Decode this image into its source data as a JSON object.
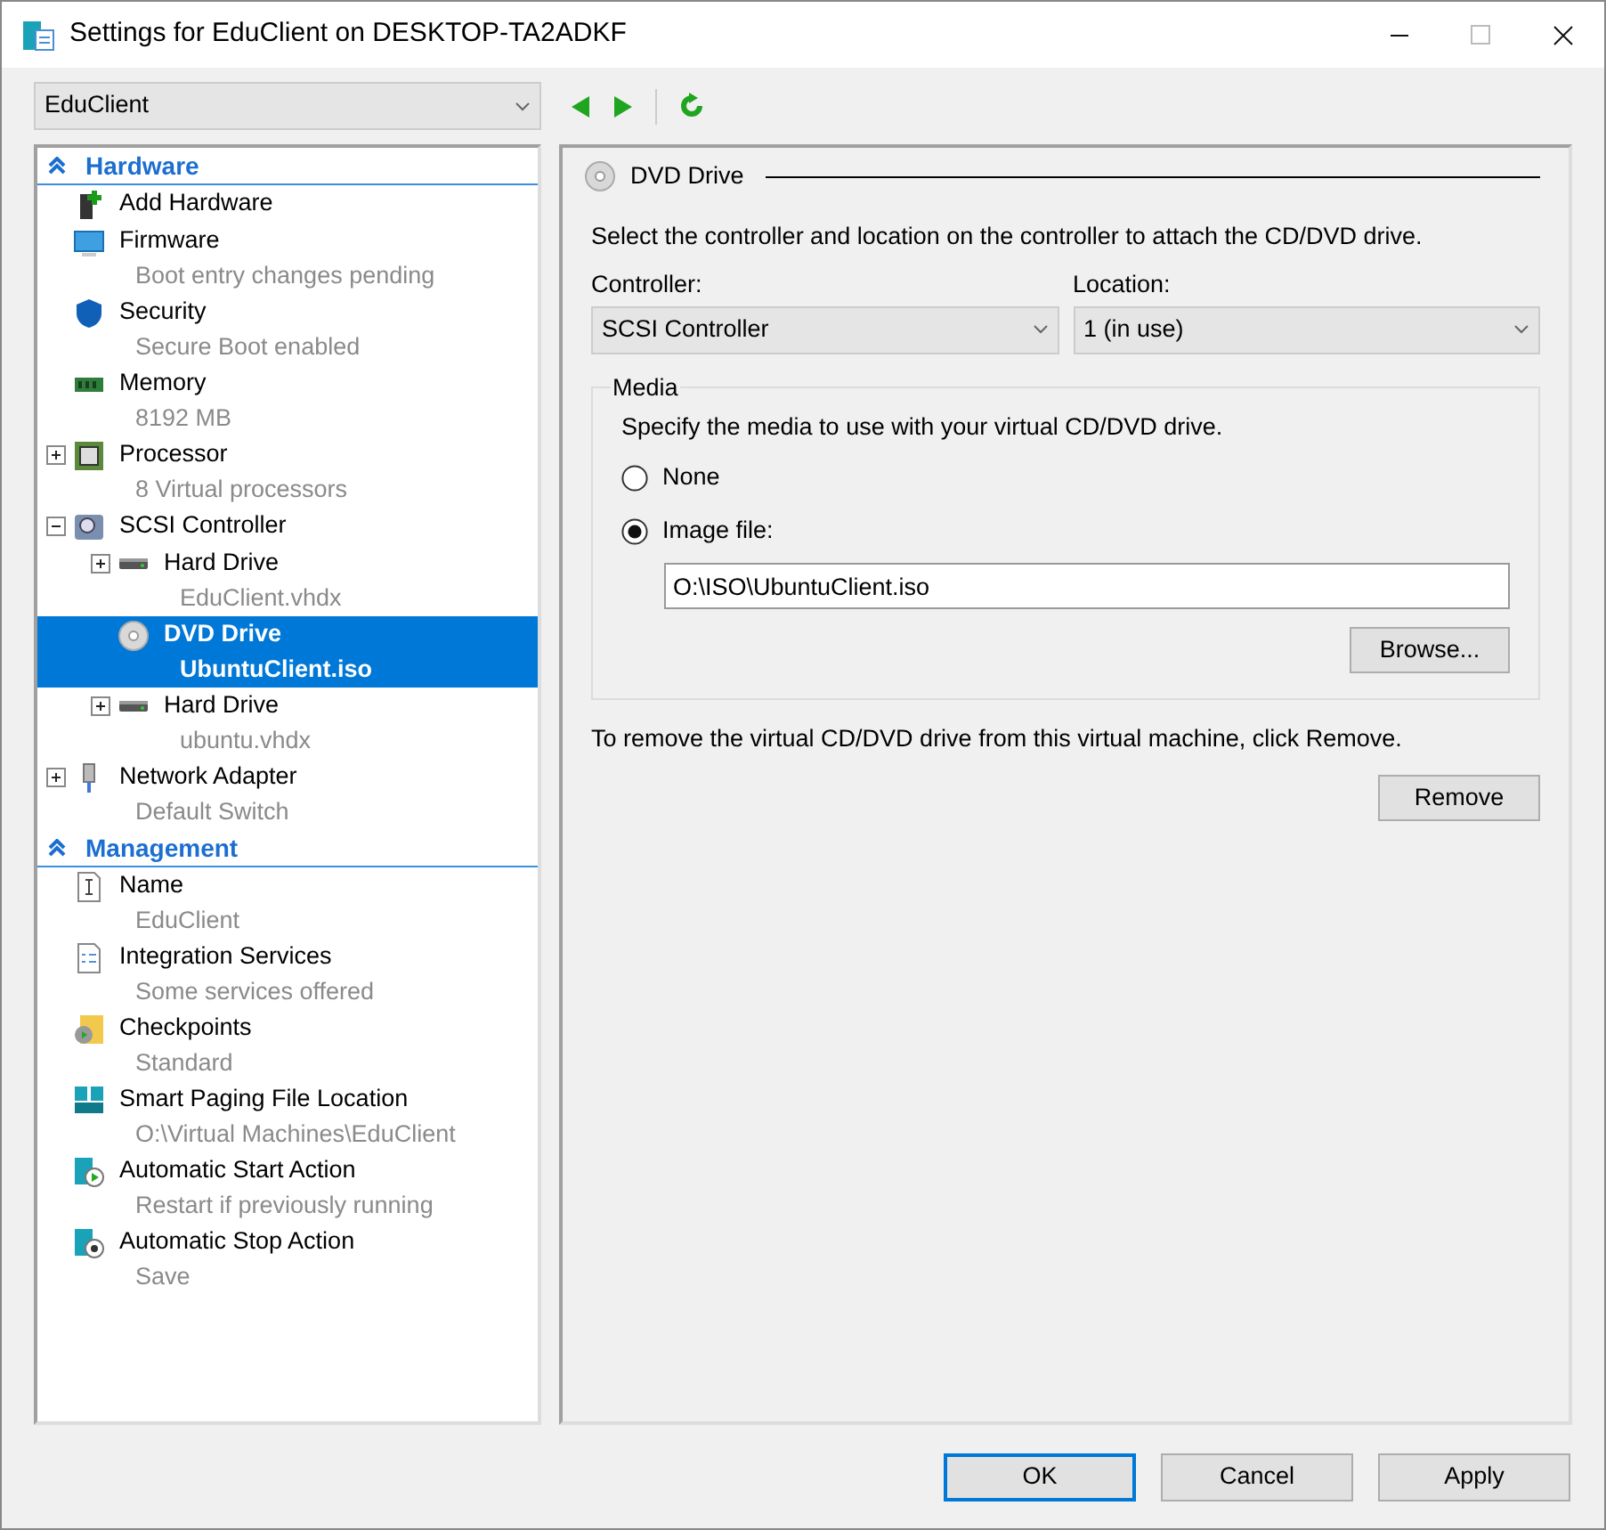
{
  "window": {
    "title": "Settings for EduClient on DESKTOP-TA2ADKF"
  },
  "vm_selector": {
    "value": "EduClient"
  },
  "sections": [
    {
      "title": "Hardware",
      "expanded": true,
      "items": [
        {
          "kind": "add",
          "label": "Add Hardware",
          "selected": false
        },
        {
          "kind": "firmware",
          "label": "Firmware",
          "detail": "Boot entry changes pending",
          "selected": false
        },
        {
          "kind": "shield",
          "label": "Security",
          "detail": "Secure Boot enabled",
          "selected": false
        },
        {
          "kind": "memory",
          "label": "Memory",
          "detail": "8192 MB",
          "selected": false
        },
        {
          "kind": "cpu",
          "label": "Processor",
          "detail": "8 Virtual processors",
          "selected": false,
          "expanded": false
        },
        {
          "kind": "controller",
          "label": "SCSI Controller",
          "selected": false,
          "expanded": true,
          "children": [
            {
              "kind": "disk",
              "label": "Hard Drive",
              "detail": "EduClient.vhdx",
              "selected": false,
              "expanded": false
            },
            {
              "kind": "dvd",
              "label": "DVD Drive",
              "detail": "UbuntuClient.iso",
              "selected": true
            },
            {
              "kind": "disk",
              "label": "Hard Drive",
              "detail": "ubuntu.vhdx",
              "selected": false,
              "expanded": false
            }
          ]
        },
        {
          "kind": "network",
          "label": "Network Adapter",
          "detail": "Default Switch",
          "selected": false,
          "expanded": false
        }
      ]
    },
    {
      "title": "Management",
      "expanded": true,
      "items": [
        {
          "kind": "name",
          "label": "Name",
          "detail": "EduClient",
          "selected": false
        },
        {
          "kind": "services",
          "label": "Integration Services",
          "detail": "Some services offered",
          "selected": false
        },
        {
          "kind": "checkpoint",
          "label": "Checkpoints",
          "detail": "Standard",
          "selected": false
        },
        {
          "kind": "paging",
          "label": "Smart Paging File Location",
          "detail": "O:\\Virtual Machines\\EduClient",
          "selected": false
        },
        {
          "kind": "start",
          "label": "Automatic Start Action",
          "detail": "Restart if previously running",
          "selected": false
        },
        {
          "kind": "stop",
          "label": "Automatic Stop Action",
          "detail": "Save",
          "selected": false
        }
      ]
    }
  ],
  "panel": {
    "title": "DVD Drive",
    "intro": "Select the controller and location on the controller to attach the CD/DVD drive.",
    "controller": {
      "label": "Controller:",
      "value": "SCSI Controller"
    },
    "location": {
      "label": "Location:",
      "value": "1 (in use)"
    },
    "media": {
      "title": "Media",
      "hint": "Specify the media to use with your virtual CD/DVD drive.",
      "options": [
        {
          "label": "None",
          "selected": false
        },
        {
          "label": "Image file:",
          "selected": true
        }
      ],
      "path": "O:\\ISO\\UbuntuClient.iso",
      "browse": "Browse..."
    },
    "remove_hint": "To remove the virtual CD/DVD drive from this virtual machine, click Remove.",
    "remove": "Remove"
  },
  "buttons": [
    {
      "label": "OK",
      "default": true
    },
    {
      "label": "Cancel",
      "default": false
    },
    {
      "label": "Apply",
      "default": false
    }
  ]
}
